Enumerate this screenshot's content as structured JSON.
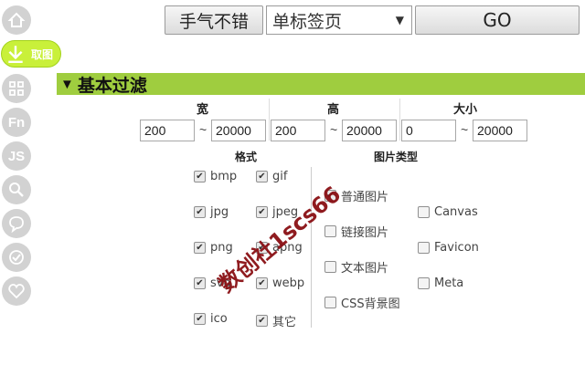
{
  "toolbar": {
    "good_button": "手气不错",
    "tab_select_value": "单标签页",
    "go_button": "GO"
  },
  "sidebar": {
    "active_label": "取图",
    "fn_label": "Fn",
    "js_label": "JS"
  },
  "section": {
    "title": "基本过滤"
  },
  "filters": {
    "width": {
      "label": "宽",
      "min": "200",
      "max": "20000"
    },
    "height": {
      "label": "高",
      "min": "200",
      "max": "20000"
    },
    "size": {
      "label": "大小",
      "min": "0",
      "max": "20000"
    },
    "tilde": "~"
  },
  "format": {
    "label": "格式",
    "items": [
      {
        "label": "bmp",
        "checked": true
      },
      {
        "label": "gif",
        "checked": true
      },
      {
        "label": "jpg",
        "checked": true
      },
      {
        "label": "jpeg",
        "checked": true
      },
      {
        "label": "png",
        "checked": true
      },
      {
        "label": "apng",
        "checked": true
      },
      {
        "label": "svg",
        "checked": true
      },
      {
        "label": "webp",
        "checked": true
      },
      {
        "label": "ico",
        "checked": true
      },
      {
        "label": "其它",
        "checked": true
      }
    ]
  },
  "image_type": {
    "label": "图片类型",
    "items": [
      {
        "label": "普通图片",
        "checked": true
      },
      {
        "label": "链接图片",
        "checked": false
      },
      {
        "label": "文本图片",
        "checked": false
      },
      {
        "label": "CSS背景图",
        "checked": false
      },
      {
        "label": "Canvas",
        "checked": false
      },
      {
        "label": "Favicon",
        "checked": false
      },
      {
        "label": "Meta",
        "checked": false
      }
    ]
  },
  "watermark": "数创社1scs66",
  "colors": {
    "section_bg": "#9fcd3f",
    "active_sidebar": "#c9f03a",
    "sidebar_icon": "#d2d2d2"
  }
}
